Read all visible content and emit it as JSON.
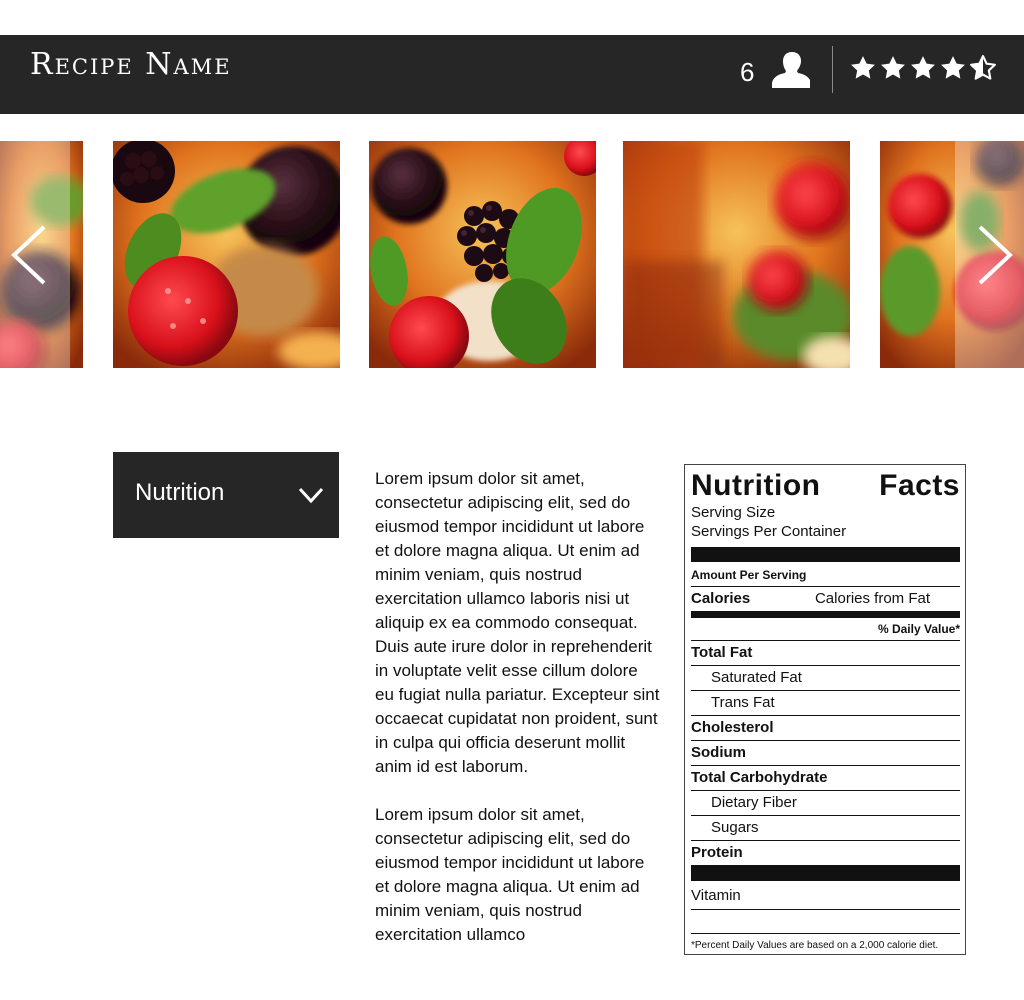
{
  "header": {
    "title": "Recipe Name",
    "servings": "6",
    "servings_icon": "person-icon",
    "rating": 4.5,
    "rating_max": 5
  },
  "carousel": {
    "prev_icon": "chevron-left-icon",
    "next_icon": "chevron-right-icon",
    "photos": [
      "berry-dessert-photo",
      "berry-dessert-photo",
      "berry-dessert-photo",
      "berry-dessert-photo",
      "berry-dessert-photo"
    ]
  },
  "nutrition_dropdown": {
    "label": "Nutrition",
    "icon": "chevron-down-icon"
  },
  "body": {
    "paragraphs": [
      "Lorem ipsum dolor sit amet, consectetur adipiscing elit, sed do eiusmod tempor incididunt ut labore et dolore magna aliqua. Ut enim ad minim veniam, quis nostrud exercitation ullamco laboris nisi ut aliquip ex ea commodo consequat. Duis aute irure dolor in reprehenderit in voluptate velit esse cillum dolore eu fugiat nulla pariatur. Excepteur sint occaecat cupidatat non proident, sunt in culpa qui officia deserunt mollit anim id est laborum.",
      "Lorem ipsum dolor sit amet, consectetur adipiscing elit, sed do eiusmod tempor incididunt ut labore et dolore magna aliqua. Ut enim ad minim veniam, quis nostrud exercitation ullamco"
    ]
  },
  "nutrition_facts": {
    "title_left": "Nutrition",
    "title_right": "Facts",
    "serving_size": "Serving Size",
    "servings_per_container": "Servings Per Container",
    "amount_per_serving": "Amount Per Serving",
    "calories": "Calories",
    "calories_from_fat": "Calories from Fat",
    "daily_value_header": "% Daily Value*",
    "rows": {
      "total_fat": "Total Fat",
      "saturated_fat": "Saturated Fat",
      "trans_fat": "Trans Fat",
      "cholesterol": "Cholesterol",
      "sodium": "Sodium",
      "total_carbohydrate": "Total Carbohydrate",
      "dietary_fiber": "Dietary Fiber",
      "sugars": "Sugars",
      "protein": "Protein"
    },
    "vitamin": "Vitamin",
    "footnote": "*Percent Daily Values are based on a 2,000 calorie diet."
  },
  "colors": {
    "header_bg": "#262626",
    "header_text": "#ffffff",
    "dropdown_bg": "#262626"
  }
}
